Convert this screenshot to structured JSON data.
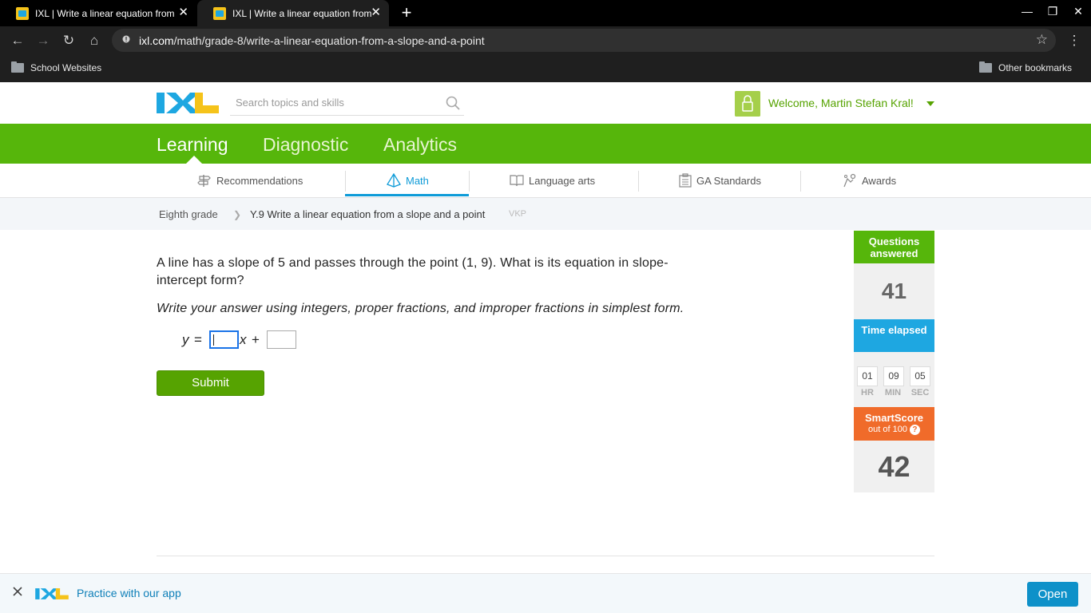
{
  "browser": {
    "tabs": [
      {
        "title": "IXL | Write a linear equation from a slope and a point"
      },
      {
        "title": "IXL | Write a linear equation from a slope and a point"
      }
    ],
    "url_host": "ixl.com",
    "url_path": "/math/grade-8/write-a-linear-equation-from-a-slope-and-a-point",
    "bookmarks": [
      {
        "label": "School Websites"
      },
      {
        "label": "Other bookmarks"
      }
    ]
  },
  "header": {
    "search_placeholder": "Search topics and skills",
    "welcome": "Welcome, Martin Stefan Kral!"
  },
  "main_nav": [
    {
      "label": "Learning",
      "active": true
    },
    {
      "label": "Diagnostic"
    },
    {
      "label": "Analytics"
    }
  ],
  "sub_nav": [
    {
      "label": "Recommendations"
    },
    {
      "label": "Math",
      "active": true
    },
    {
      "label": "Language arts"
    },
    {
      "label": "GA Standards"
    },
    {
      "label": "Awards"
    }
  ],
  "breadcrumb": {
    "grade": "Eighth grade",
    "skill": "Y.9 Write a linear equation from a slope and a point",
    "code": "VKP"
  },
  "question": {
    "text": "A line has a slope of 5 and passes through the point (1, 9). What is its equation in slope-intercept form?",
    "instruction": "Write your answer using integers, proper fractions, and improper fractions in simplest form.",
    "eq_y": "y",
    "eq_equals": "=",
    "eq_x": "x",
    "eq_plus": "+",
    "submit_label": "Submit"
  },
  "stats": {
    "questions_answered_label": "Questions answered",
    "questions_answered": "41",
    "time_elapsed_label": "Time elapsed",
    "time": {
      "hr": "01",
      "min": "09",
      "sec": "05"
    },
    "time_units": {
      "hr": "HR",
      "min": "MIN",
      "sec": "SEC"
    },
    "smartscore_label": "SmartScore",
    "smartscore_sub": "out of 100",
    "smartscore_help": "?",
    "smartscore": "42"
  },
  "banner": {
    "message": "Practice with our app",
    "open_label": "Open"
  },
  "colors": {
    "ixl_green": "#56b60b",
    "ixl_blue": "#1ea7e1",
    "smartscore_orange": "#f06b2a"
  }
}
